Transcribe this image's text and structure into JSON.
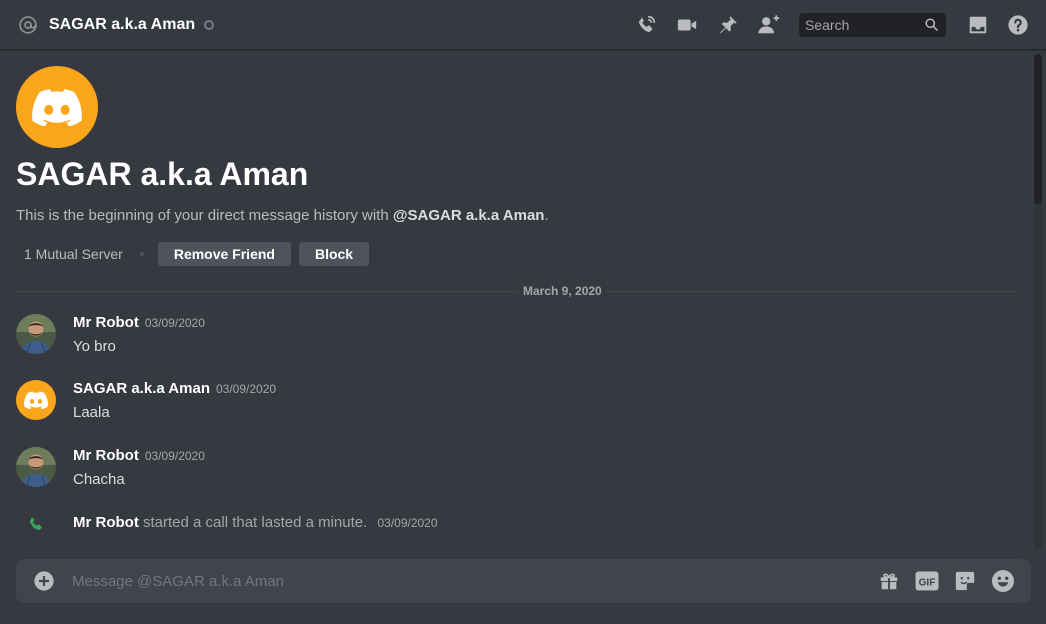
{
  "header": {
    "title": "SAGAR a.k.a Aman",
    "search_placeholder": "Search"
  },
  "intro": {
    "name": "SAGAR a.k.a Aman",
    "desc_prefix": "This is the beginning of your direct message history with ",
    "desc_mention": "@SAGAR a.k.a Aman",
    "desc_suffix": ".",
    "mutual": "1 Mutual Server",
    "remove_friend": "Remove Friend",
    "block": "Block"
  },
  "divider_date": "March 9, 2020",
  "messages": [
    {
      "user": "Mr Robot",
      "time": "03/09/2020",
      "text": "Yo bro",
      "avatar": "photo"
    },
    {
      "user": "SAGAR a.k.a Aman",
      "time": "03/09/2020",
      "text": "Laala",
      "avatar": "discord"
    },
    {
      "user": "Mr Robot",
      "time": "03/09/2020",
      "text": "Chacha",
      "avatar": "photo"
    }
  ],
  "system_message": {
    "user": "Mr Robot",
    "text": " started a call that lasted a minute.",
    "time": "03/09/2020"
  },
  "composer": {
    "placeholder": "Message @SAGAR a.k.a Aman"
  },
  "colors": {
    "background": "#36393f",
    "avatar_orange": "#faa61a",
    "call_green": "#3ba55c",
    "button_gray": "#4f545c"
  },
  "icons": [
    "at-icon",
    "status-offline-icon",
    "voice-call-icon",
    "video-call-icon",
    "pin-icon",
    "add-friend-icon",
    "search-icon",
    "inbox-icon",
    "help-icon",
    "discord-logo-icon",
    "phone-icon",
    "add-attachment-icon",
    "gift-icon",
    "gif-icon",
    "sticker-icon",
    "emoji-icon"
  ]
}
